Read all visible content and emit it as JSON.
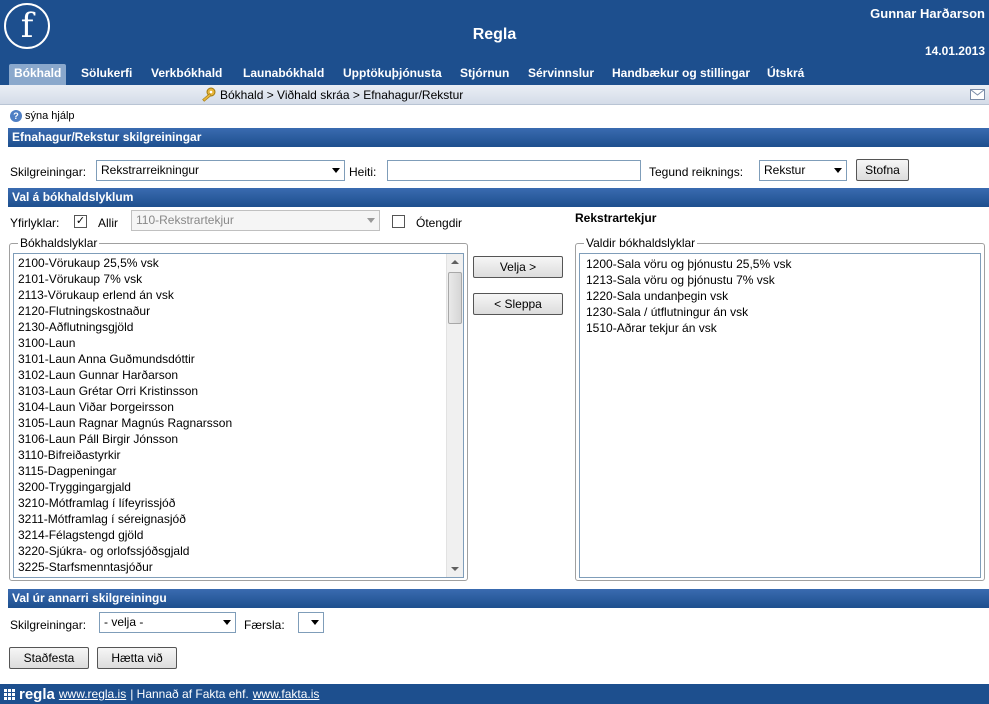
{
  "header": {
    "logo_letter": "f",
    "app_title": "Regla",
    "user_name": "Gunnar Harðarson",
    "date": "14.01.2013"
  },
  "nav": [
    {
      "label": "Bókhald",
      "active": true
    },
    {
      "label": "Sölukerfi"
    },
    {
      "label": "Verkbókhald"
    },
    {
      "label": "Launabókhald"
    },
    {
      "label": "Upptökuþjónusta"
    },
    {
      "label": "Stjórnun"
    },
    {
      "label": "Sérvinnslur"
    },
    {
      "label": "Handbækur og stillingar"
    },
    {
      "label": "Útskrá"
    }
  ],
  "breadcrumb": "Bókhald > Viðhald skráa > Efnahagur/Rekstur",
  "help_label": "sýna hjálp",
  "section1": {
    "title": "Efnahagur/Rekstur skilgreiningar",
    "skilgreiningar_label": "Skilgreiningar:",
    "skilgreiningar_value": "Rekstrarreikningur",
    "heiti_label": "Heiti:",
    "heiti_value": "",
    "tegund_label": "Tegund reiknings:",
    "tegund_value": "Rekstur",
    "stofna_label": "Stofna"
  },
  "section2": {
    "title": "Val á bókhaldslyklum",
    "yfirlyklar_label": "Yfirlyklar:",
    "allir_label": "Allir",
    "allir_checked": true,
    "yfirlykill_value": "110-Rekstrartekjur",
    "otengdir_label": "Ótengdir",
    "otengdir_checked": false,
    "selected_group_title": "Rekstrartekjur",
    "available_legend": "Bókhaldslyklar",
    "selected_legend": "Valdir bókhaldslyklar",
    "velja_label": "Velja >",
    "sleppa_label": "< Sleppa",
    "available_accounts": [
      "2100-Vörukaup 25,5% vsk",
      "2101-Vörukaup 7% vsk",
      "2113-Vörukaup erlend án vsk",
      "2120-Flutningskostnaður",
      "2130-Aðflutningsgjöld",
      "3100-Laun",
      "3101-Laun Anna Guðmundsdóttir",
      "3102-Laun Gunnar Harðarson",
      "3103-Laun Grétar Orri Kristinsson",
      "3104-Laun Viðar Þorgeirsson",
      "3105-Laun Ragnar Magnús Ragnarsson",
      "3106-Laun Páll Birgir Jónsson",
      "3110-Bifreiðastyrkir",
      "3115-Dagpeningar",
      "3200-Tryggingargjald",
      "3210-Mótframlag í lífeyrissjóð",
      "3211-Mótframlag í séreignasjóð",
      "3214-Félagstengd gjöld",
      "3220-Sjúkra- og orlofssjóðsgjald",
      "3225-Starfsmenntasjóður"
    ],
    "selected_accounts": [
      "1200-Sala vöru og þjónustu 25,5% vsk",
      "1213-Sala vöru og þjónustu 7% vsk",
      "1220-Sala undanþegin vsk",
      "1230-Sala / útflutningur án vsk",
      "1510-Aðrar tekjur án vsk"
    ]
  },
  "section3": {
    "title": "Val úr annarri skilgreiningu",
    "skilgreiningar_label": "Skilgreiningar:",
    "skilgreiningar_value": "- velja -",
    "faersla_label": "Færsla:",
    "faersla_value": ""
  },
  "actions": {
    "confirm_label": "Staðfesta",
    "cancel_label": "Hætta við"
  },
  "footer": {
    "brand": "regla",
    "link1": "www.regla.is",
    "text": "| Hannað af Fakta ehf.",
    "link2": "www.fakta.is"
  },
  "colors": {
    "header_bg": "#1d4f8e",
    "section_bar": "#2a5ea4",
    "active_tab": "#8aa8cc"
  }
}
